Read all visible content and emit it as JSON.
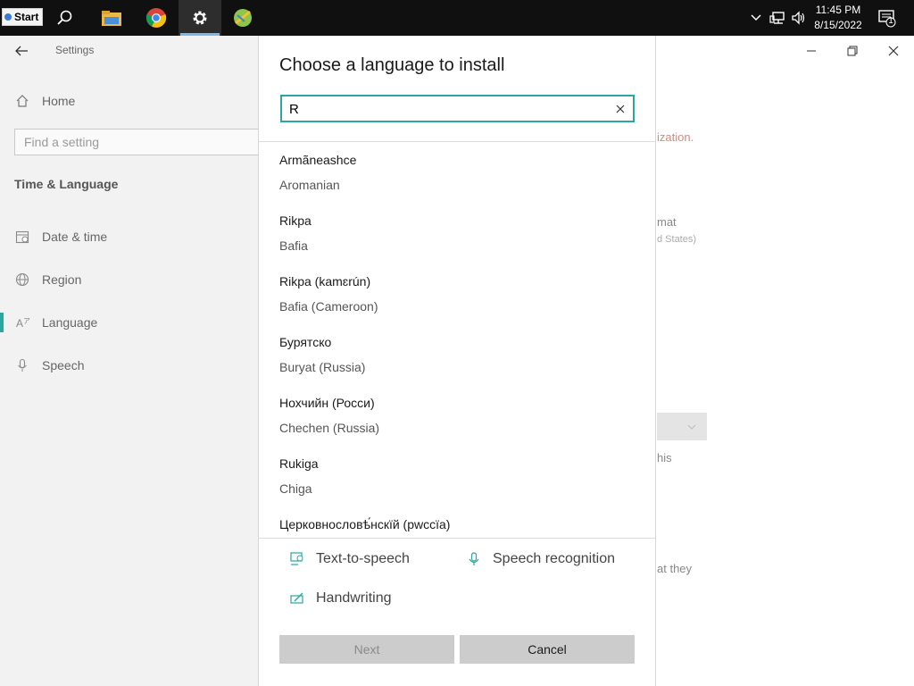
{
  "taskbar": {
    "start_label": "Start",
    "apps": [
      {
        "icon": "search-icon"
      },
      {
        "icon": "file-explorer-icon"
      },
      {
        "icon": "chrome-icon"
      },
      {
        "icon": "settings-gear-icon"
      },
      {
        "icon": "app-icon"
      }
    ],
    "clock_time": "11:45 PM",
    "clock_date": "8/15/2022",
    "notification_count": "1"
  },
  "settings": {
    "window_title": "Settings",
    "home_label": "Home",
    "search_placeholder": "Find a setting",
    "section_title": "Time & Language",
    "nav": [
      {
        "label": "Date & time",
        "icon": "calendar-icon"
      },
      {
        "label": "Region",
        "icon": "globe-icon"
      },
      {
        "label": "Language",
        "icon": "language-icon"
      },
      {
        "label": "Speech",
        "icon": "microphone-icon"
      }
    ],
    "bg_fragments": {
      "warning": "ization.",
      "format": "mat",
      "format_sub": "d States)",
      "text_this": "his",
      "text_they": "at they"
    }
  },
  "dialog": {
    "title": "Choose a language to install",
    "search_value": "R",
    "languages": [
      {
        "native": "Armãneashce",
        "english": "Aromanian"
      },
      {
        "native": "Rikpa",
        "english": "Bafia"
      },
      {
        "native": "Rikpa (kamɛrún)",
        "english": "Bafia (Cameroon)"
      },
      {
        "native": "Бурятско",
        "english": "Buryat (Russia)"
      },
      {
        "native": "Нохчийн (Росси)",
        "english": "Chechen (Russia)"
      },
      {
        "native": "Rukiga",
        "english": "Chiga"
      },
      {
        "native": "Церковнословѣ́нскїй (рwссїа)",
        "english": ""
      }
    ],
    "features": {
      "tts": "Text-to-speech",
      "speech": "Speech recognition",
      "handwriting": "Handwriting"
    },
    "next_label": "Next",
    "cancel_label": "Cancel"
  },
  "colors": {
    "accent": "#2aa7a0",
    "taskbar": "#101010"
  }
}
